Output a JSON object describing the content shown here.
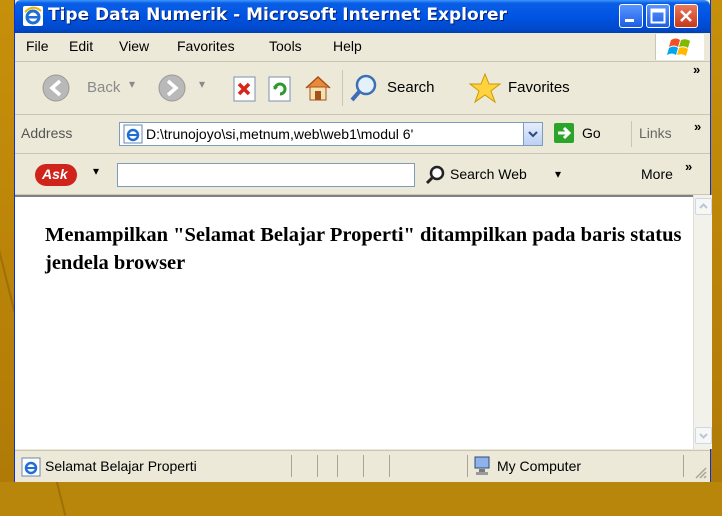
{
  "window": {
    "title": "Tipe Data Numerik - Microsoft Internet Explorer"
  },
  "menu": {
    "items": [
      "File",
      "Edit",
      "View",
      "Favorites",
      "Tools",
      "Help"
    ]
  },
  "toolbar": {
    "back_label": "Back",
    "search_label": "Search",
    "favorites_label": "Favorites"
  },
  "address": {
    "label": "Address",
    "url": "D:\\trunojoyo\\si,metnum,web\\web1\\modul 6'",
    "go_label": "Go",
    "links_label": "Links"
  },
  "askbar": {
    "logo_text": "Ask",
    "search_value": "",
    "search_web_label": "Search Web",
    "more_label": "More"
  },
  "content": {
    "text": "Menampilkan \"Selamat Belajar Properti\" ditampilkan pada baris status jendela browser"
  },
  "status": {
    "text": "Selamat Belajar Properti",
    "zone": "My Computer"
  },
  "colors": {
    "titlebar": "#0054e3",
    "desktop_bg": "#b8860b",
    "chrome": "#ece9d8"
  }
}
